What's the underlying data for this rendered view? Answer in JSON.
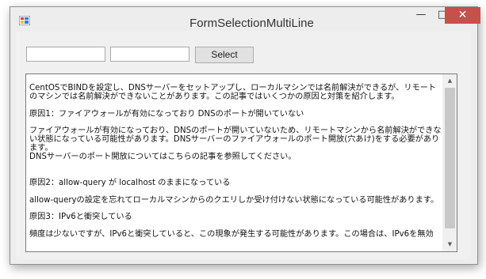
{
  "window": {
    "title": "FormSelectionMultiLine",
    "controls": {
      "minimize": "—",
      "maximize": "□",
      "close": "✕"
    }
  },
  "toolbar": {
    "textbox1_value": "",
    "textbox2_value": "",
    "select_label": "Select"
  },
  "content": {
    "paragraphs": [
      "CentOSでBINDを設定し、DNSサーバーをセットアップし、ローカルマシンでは名前解決ができるが、リモートのマシンでは名前解決ができないことがあります。この記事ではいくつかの原因と対策を紹介します。",
      "原因1：ファイアウォールが有効になっており DNSのポートが開いていない",
      "ファイアウォールが有効になっており、DNSのポートが開いていないため、リモートマシンから名前解決ができない状態になっている可能性があります。DNSサーバーのファイアウォールのポート開放(穴あけ)をする必要があります。\nDNSサーバーのポート開放についてはこちらの記事を参照してください。",
      "原因2：allow-query が localhost のままになっている",
      "allow-queryの設定を忘れてローカルマシンからのクエリしか受け付けない状態になっている可能性があります。",
      "原因3：IPv6と衝突している",
      "頻度は少ないですが、IPv6と衝突していると、この現象が発生する可能性があります。この場合は、IPv6を無効"
    ]
  },
  "scrollbar": {
    "up_arrow": "▲",
    "down_arrow": "▼",
    "position": 0.0
  }
}
